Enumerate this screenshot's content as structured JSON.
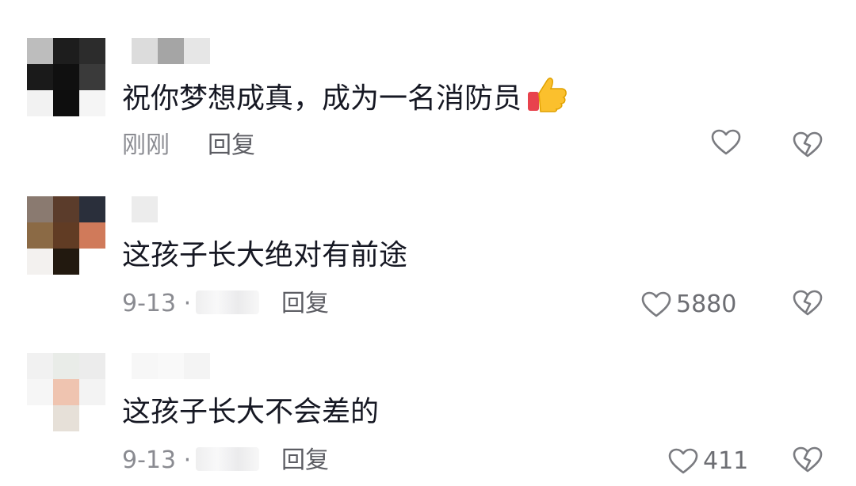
{
  "comments": [
    {
      "text": "祝你梦想成真，成为一名消防员",
      "emoji": "thumbs-up-icon",
      "time": "刚刚",
      "location": "",
      "reply_label": "回复",
      "likes": "",
      "avatar_colors": [
        "#bdbdbd",
        "#1d1d1d",
        "#2c2c2c",
        "#1a1a1a",
        "#101010",
        "#3a3a3a",
        "#f2f2f2",
        "#0e0e0e",
        "#f5f5f5"
      ],
      "username_colors": [
        "#dcdcdc",
        "#a5a5a5",
        "#e6e6e6"
      ]
    },
    {
      "text": "这孩子长大绝对有前途",
      "emoji": "",
      "time": "9-13 ·",
      "location": "",
      "reply_label": "回复",
      "likes": "5880",
      "avatar_colors": [
        "#8a7a70",
        "#5b3c2b",
        "#2a2f3b",
        "#8b6a45",
        "#613c24",
        "#d07a5a",
        "#f3f1ef",
        "#22190f",
        "#ffffff"
      ],
      "username_colors": [
        "#ececec",
        "#ffffff",
        "#ffffff"
      ]
    },
    {
      "text": "这孩子长大不会差的",
      "emoji": "",
      "time": "9-13 ·",
      "location": "",
      "reply_label": "回复",
      "likes": "411",
      "avatar_colors": [
        "#f1f1f1",
        "#e9ece8",
        "#ececec",
        "#f6f6f6",
        "#efc4b0",
        "#f3f3f3",
        "#ffffff",
        "#e6e0d8",
        "#ffffff"
      ],
      "username_colors": [
        "#f7f7f7",
        "#f9f9f9",
        "#f4f4f4"
      ]
    }
  ],
  "icons": {
    "like": "heart-outline-icon",
    "dislike": "broken-heart-icon"
  },
  "colors": {
    "text": "#161823",
    "meta": "#8a8b91",
    "icon_stroke": "#7a7b80"
  }
}
